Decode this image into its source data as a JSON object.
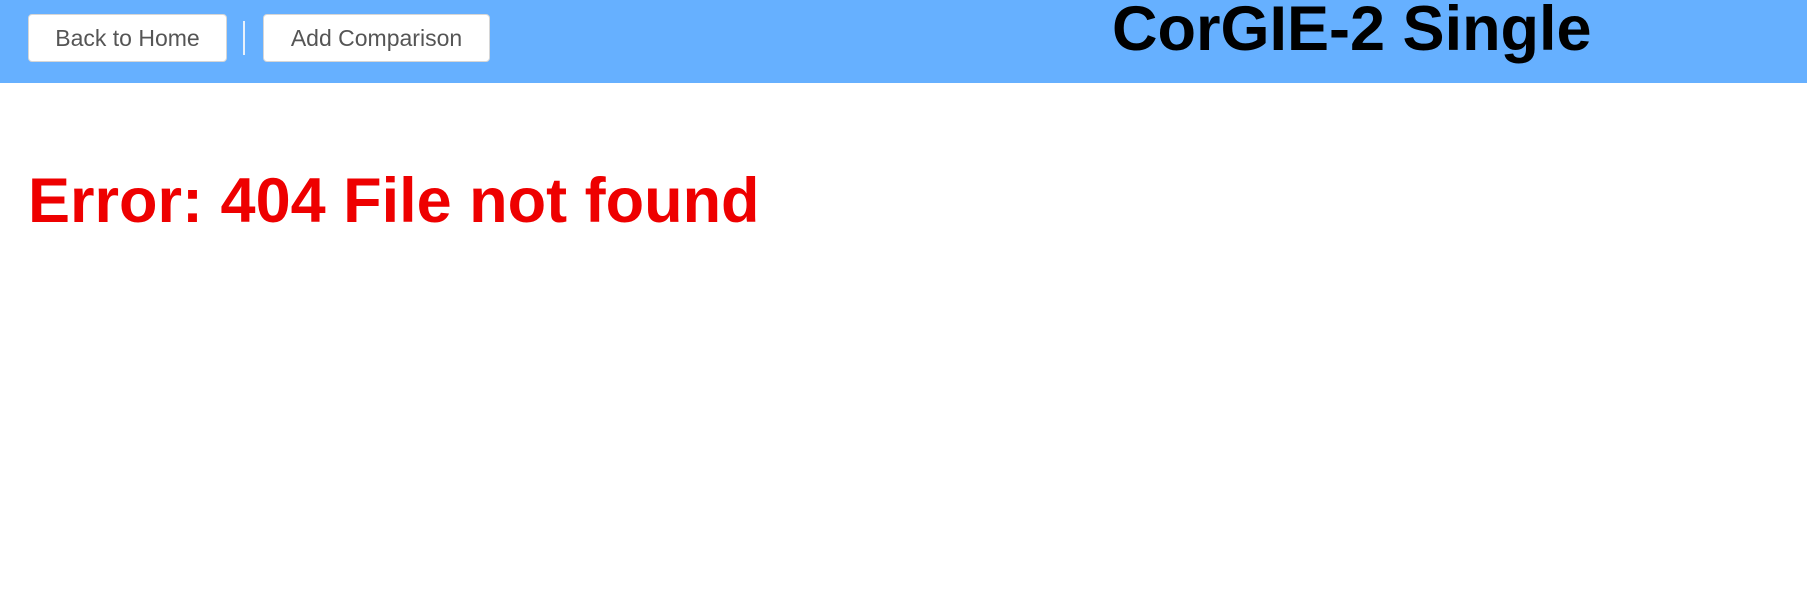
{
  "header": {
    "back_home_label": "Back to Home",
    "add_comparison_label": "Add Comparison",
    "title": "CorGIE-2 Single",
    "background_color": "#66b0ff"
  },
  "main": {
    "error_text": "Error: 404 File not found",
    "error_color": "#ee0000"
  }
}
